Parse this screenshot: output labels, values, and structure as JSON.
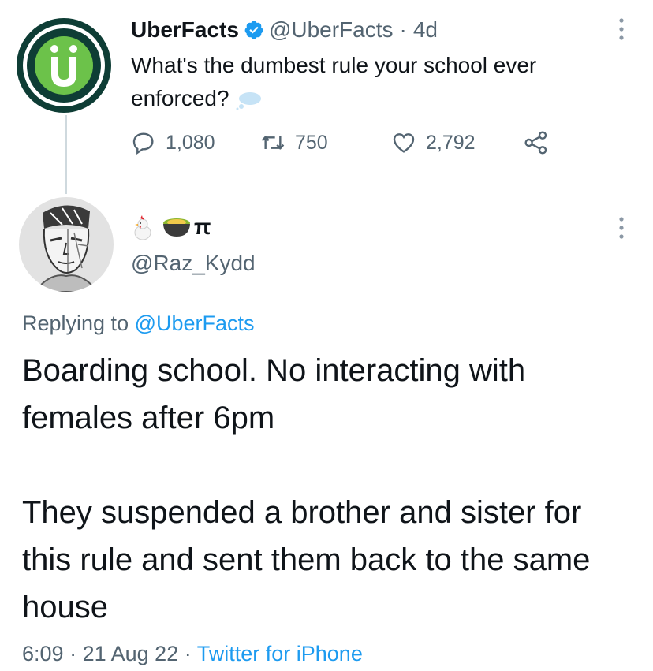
{
  "original_tweet": {
    "author_name": "UberFacts",
    "handle": "@UberFacts",
    "separator": "·",
    "time": "4d",
    "text": "What's the dumbest rule your school ever enforced?",
    "avatar_letter": "Ü",
    "avatar_color": "#6cc24a",
    "stats": {
      "replies": "1,080",
      "retweets": "750",
      "likes": "2,792"
    }
  },
  "reply_tweet": {
    "display_name_suffix": "π",
    "display_name_icons": [
      "chicken-emoji",
      "bowl-emoji"
    ],
    "handle": "@Raz_Kydd",
    "replying_prefix": "Replying to",
    "replying_to": "@UberFacts",
    "paragraphs": [
      "Boarding school. No interacting with females after 6pm",
      "They suspended a brother and sister for this rule and sent them back to the same house"
    ],
    "meta": {
      "time": "6:09",
      "separator": "·",
      "date": "21 Aug 22",
      "source": "Twitter for iPhone"
    }
  },
  "colors": {
    "text_primary": "#0f1419",
    "text_secondary": "#536471",
    "link": "#1d9bf0",
    "verified": "#1d9bf0"
  }
}
